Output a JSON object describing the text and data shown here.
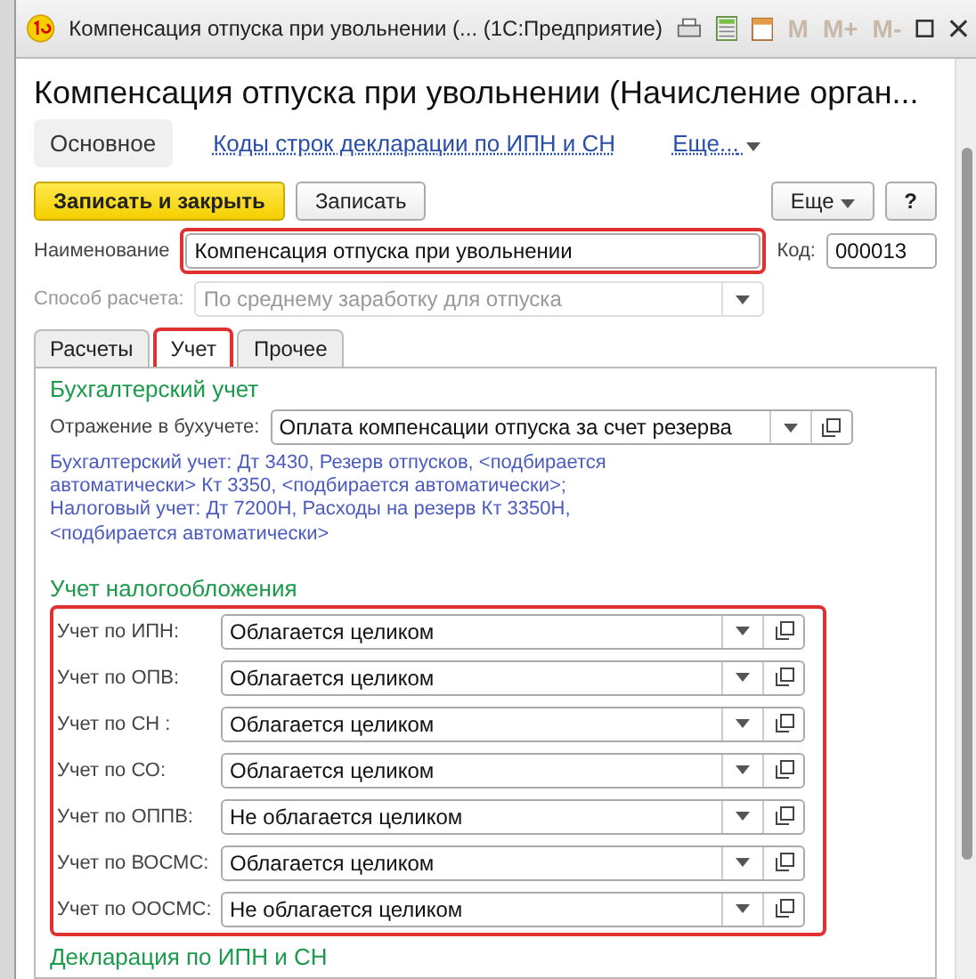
{
  "window": {
    "title": "Компенсация отпуска при увольнении (...  (1С:Предприятие)",
    "toolbar_marks": [
      "M",
      "M+",
      "M-"
    ]
  },
  "form_title": "Компенсация отпуска при увольнении (Начисление орган...",
  "nav": [
    {
      "label": "Основное",
      "selected": true
    },
    {
      "label": "Коды строк декларации по ИПН и СН",
      "selected": false
    }
  ],
  "nav_more": "Еще...",
  "command_bar": {
    "primary": "Записать и закрыть",
    "secondary": "Записать",
    "more": "Еще",
    "help": "?"
  },
  "name_field": {
    "label": "Наименование",
    "value": "Компенсация отпуска при увольнении",
    "highlighted": true
  },
  "code_field": {
    "label": "Код:",
    "value": "000013"
  },
  "calc_method": {
    "label": "Способ расчета:",
    "value": "По среднему заработку для отпуска",
    "disabled": true
  },
  "tabs": [
    {
      "label": "Расчеты",
      "selected": false,
      "highlighted": false
    },
    {
      "label": "Учет",
      "selected": true,
      "highlighted": true
    },
    {
      "label": "Прочее",
      "selected": false,
      "highlighted": false
    }
  ],
  "accounting": {
    "heading": "Бухгалтерский учет",
    "label": "Отражение в бухучете:",
    "value": "Оплата компенсации отпуска за счет резерва",
    "description": [
      "Бухгалтерский учет: Дт 3430, Резерв отпусков, <подбирается автоматически> Кт 3350, <подбирается автоматически>;",
      "Налоговый учет: Дт 7200Н, Расходы на резерв Кт 3350Н, <подбирается автоматически>"
    ]
  },
  "taxation": {
    "heading": "Учет налогообложения",
    "highlighted": true,
    "rows": [
      {
        "label": "Учет по ИПН:",
        "value": "Облагается целиком"
      },
      {
        "label": "Учет по ОПВ:",
        "value": "Облагается целиком"
      },
      {
        "label": "Учет по СН :",
        "value": "Облагается целиком"
      },
      {
        "label": "Учет по СО:",
        "value": "Облагается целиком"
      },
      {
        "label": "Учет по ОППВ:",
        "value": "Не облагается целиком"
      },
      {
        "label": "Учет по ВОСМС:",
        "value": "Облагается целиком"
      },
      {
        "label": "Учет по ООСМС:",
        "value": "Не облагается целиком"
      }
    ]
  },
  "next_heading": "Декларация по ИПН и СН"
}
